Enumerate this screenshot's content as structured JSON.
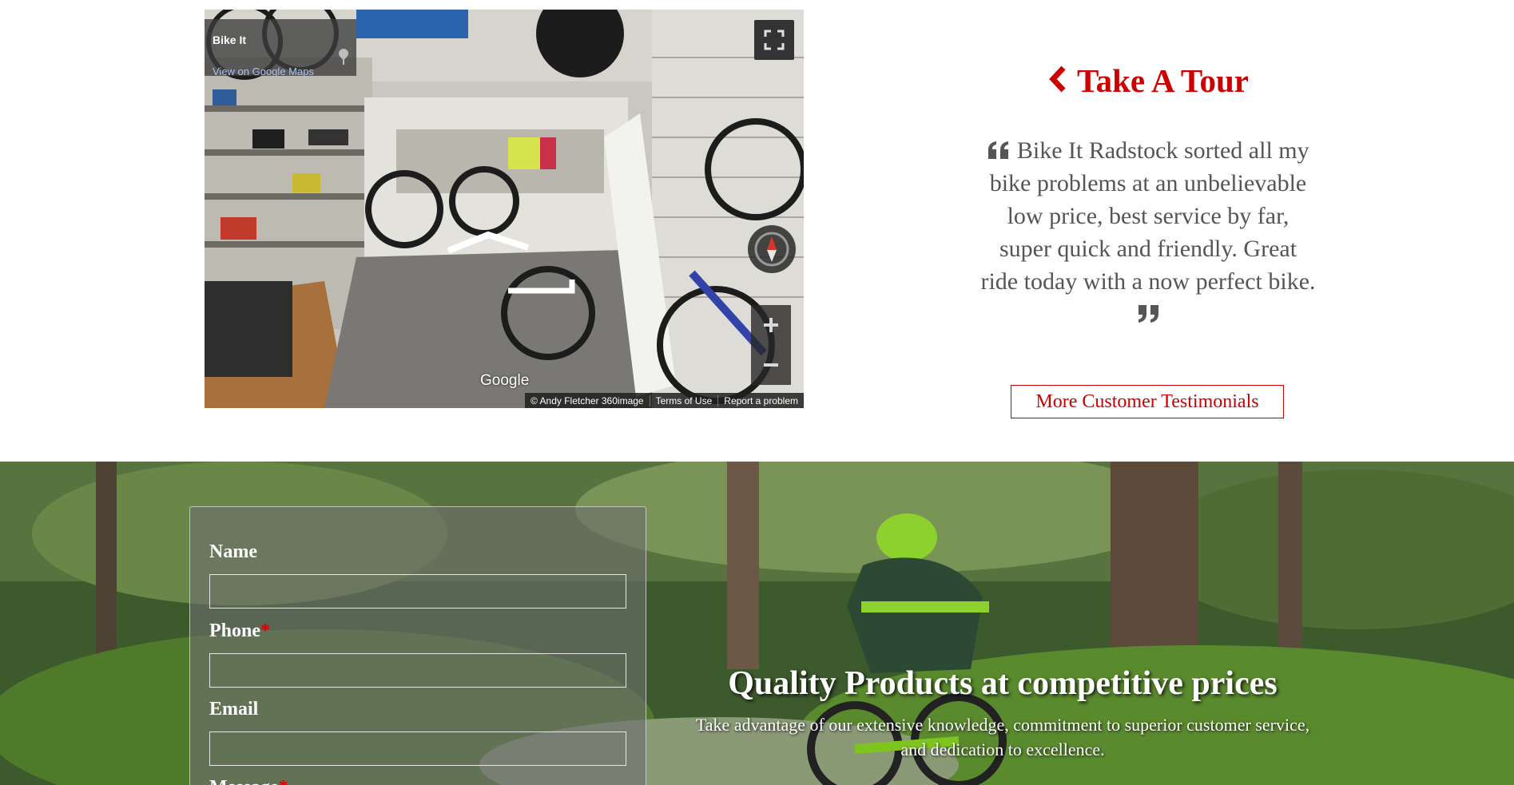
{
  "streetview": {
    "place_name": "Bike It",
    "map_link": "View on Google Maps",
    "google_logo": "Google",
    "footer": {
      "copyright": "© Andy Fletcher 360image",
      "terms": "Terms of Use",
      "report": "Report a problem"
    },
    "icons": [
      "pin-icon",
      "fullscreen-icon",
      "compass-icon",
      "zoom-in-icon",
      "zoom-out-icon"
    ]
  },
  "tour": {
    "heading": "Take A Tour",
    "icon": "chevron-left-icon"
  },
  "testimonial": {
    "text": "Bike It Radstock sorted all my bike problems at an unbelievable low price, best service by far, super quick and friendly. Great ride today with a now perfect bike.",
    "open_quote_icon": "quote-left-icon",
    "close_quote_icon": "quote-right-icon"
  },
  "more_button": "More Customer Testimonials",
  "form": {
    "name_label": "Name",
    "phone_label": "Phone",
    "email_label": "Email",
    "message_label": "Message",
    "required_mark": "*"
  },
  "hero": {
    "title": "Quality Products at competitive prices",
    "subtitle": "Take advantage of our extensive knowledge, commitment to superior customer service, and dedication to excellence."
  },
  "colors": {
    "accent": "#cc0000",
    "testimonial_text": "#555555",
    "hero_text": "#ffffff"
  }
}
